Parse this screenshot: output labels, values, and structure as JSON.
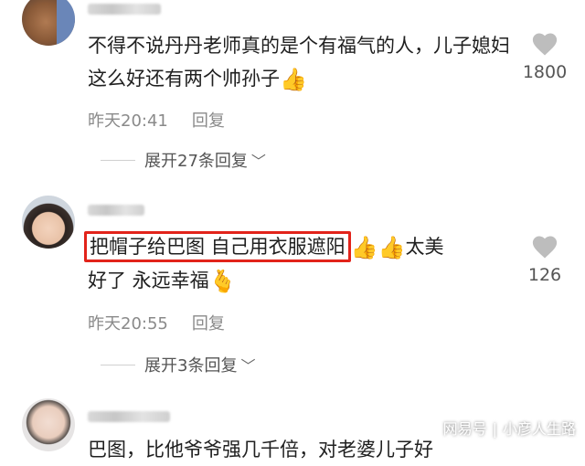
{
  "comments": [
    {
      "text": "不得不说丹丹老师真的是个有福气的人，儿子媳妇这么好还有两个帅孙子",
      "emoji_after": "👍",
      "time": "昨天20:41",
      "reply_label": "回复",
      "likes": "1800",
      "expand_label": "展开27条回复"
    },
    {
      "highlighted_text": "把帽子给巴图 自己用衣服遮阳",
      "emoji_mid": "👍👍",
      "text_tail_1": "太美",
      "text_line2": "好了 永远幸福",
      "emoji_after": "🫰",
      "time": "昨天20:55",
      "reply_label": "回复",
      "likes": "126",
      "expand_label": "展开3条回复"
    },
    {
      "text_partial": "巴图，比他爷爷强几千倍，对老婆儿子好"
    }
  ],
  "watermark": {
    "site": "网易号",
    "author": "小彦人生路"
  },
  "colors": {
    "highlight_border": "#e2231a",
    "meta_gray": "#8a8a8a"
  }
}
